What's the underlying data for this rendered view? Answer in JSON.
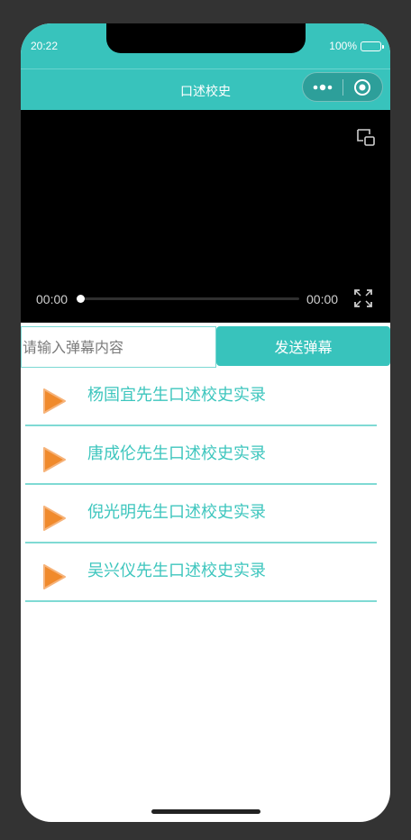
{
  "status": {
    "time": "20:22",
    "battery": "100%"
  },
  "nav": {
    "title": "口述校史"
  },
  "video": {
    "current_time": "00:00",
    "total_time": "00:00",
    "progress": 0
  },
  "danmu": {
    "placeholder": "请输入弹幕内容",
    "value": "",
    "send_label": "发送弹幕"
  },
  "list": {
    "items": [
      {
        "title": "杨国宜先生口述校史实录"
      },
      {
        "title": "唐成伦先生口述校史实录"
      },
      {
        "title": "倪光明先生口述校史实录"
      },
      {
        "title": "吴兴仪先生口述校史实录"
      }
    ]
  },
  "colors": {
    "accent": "#38c3bc",
    "divider": "#7fdad4",
    "play_icon": "#f08a2c"
  }
}
